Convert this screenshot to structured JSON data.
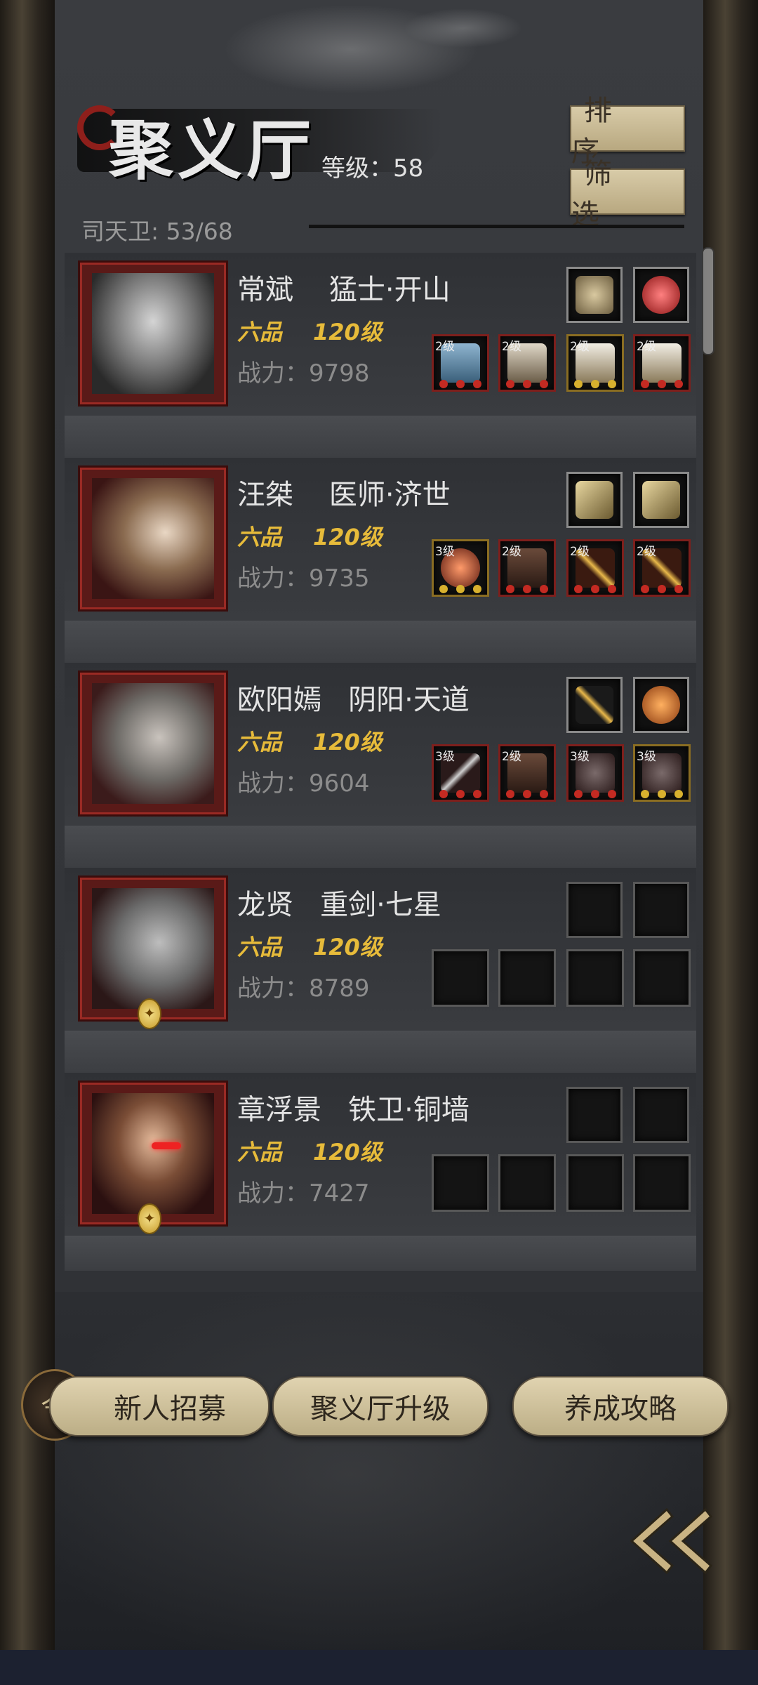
{
  "header": {
    "title": "聚义厅",
    "level_text": "等级：58",
    "sort_label": "排 序",
    "filter_label": "筛 选",
    "guard_count": "司天卫: 53/68"
  },
  "heroes": [
    {
      "name": "常斌",
      "title": "猛士·开山",
      "grade": "六品",
      "level": "120级",
      "power": "战力：9798",
      "top_icons": [
        "comb-icon",
        "red-gem-icon"
      ],
      "gear": [
        {
          "icon": "hammer-icon",
          "level": "2级",
          "rarity": "red"
        },
        {
          "icon": "armor-icon",
          "level": "2级",
          "rarity": "red"
        },
        {
          "icon": "boots-icon",
          "level": "2级",
          "rarity": "gold"
        },
        {
          "icon": "boots-icon",
          "level": "2级",
          "rarity": "red"
        }
      ]
    },
    {
      "name": "汪桀",
      "title": "医师·济世",
      "grade": "六品",
      "level": "120级",
      "power": "战力：9735",
      "top_icons": [
        "feather-icon",
        "feather-icon"
      ],
      "gear": [
        {
          "icon": "orb-icon",
          "level": "3级",
          "rarity": "gold"
        },
        {
          "icon": "robe-icon",
          "level": "2级",
          "rarity": "red"
        },
        {
          "icon": "hairpin-icon",
          "level": "2级",
          "rarity": "red"
        },
        {
          "icon": "hairpin-icon",
          "level": "2级",
          "rarity": "red"
        }
      ]
    },
    {
      "name": "欧阳嫣",
      "title": "阴阳·天道",
      "grade": "六品",
      "level": "120级",
      "power": "战力：9604",
      "top_icons": [
        "hairpin-icon",
        "amber-gem-icon"
      ],
      "gear": [
        {
          "icon": "spear-icon",
          "level": "3级",
          "rarity": "red"
        },
        {
          "icon": "robe-icon",
          "level": "2级",
          "rarity": "red"
        },
        {
          "icon": "shield-icon",
          "level": "3级",
          "rarity": "red"
        },
        {
          "icon": "shield-icon",
          "level": "3级",
          "rarity": "gold"
        }
      ]
    },
    {
      "name": "龙贤",
      "title": "重剑·七星",
      "grade": "六品",
      "level": "120级",
      "power": "战力：8789",
      "top_icons": [],
      "gear": []
    },
    {
      "name": "章浮景",
      "title": "铁卫·铜墙",
      "grade": "六品",
      "level": "120级",
      "power": "战力：7427",
      "top_icons": [],
      "gear": []
    }
  ],
  "actions": {
    "recruit": "新人招募",
    "upgrade": "聚义厅升级",
    "guide": "养成攻略"
  },
  "colors": {
    "accent_gold": "#e7bb3a",
    "frame_red": "#9a2a24",
    "button_beige": "#d8cba8"
  }
}
